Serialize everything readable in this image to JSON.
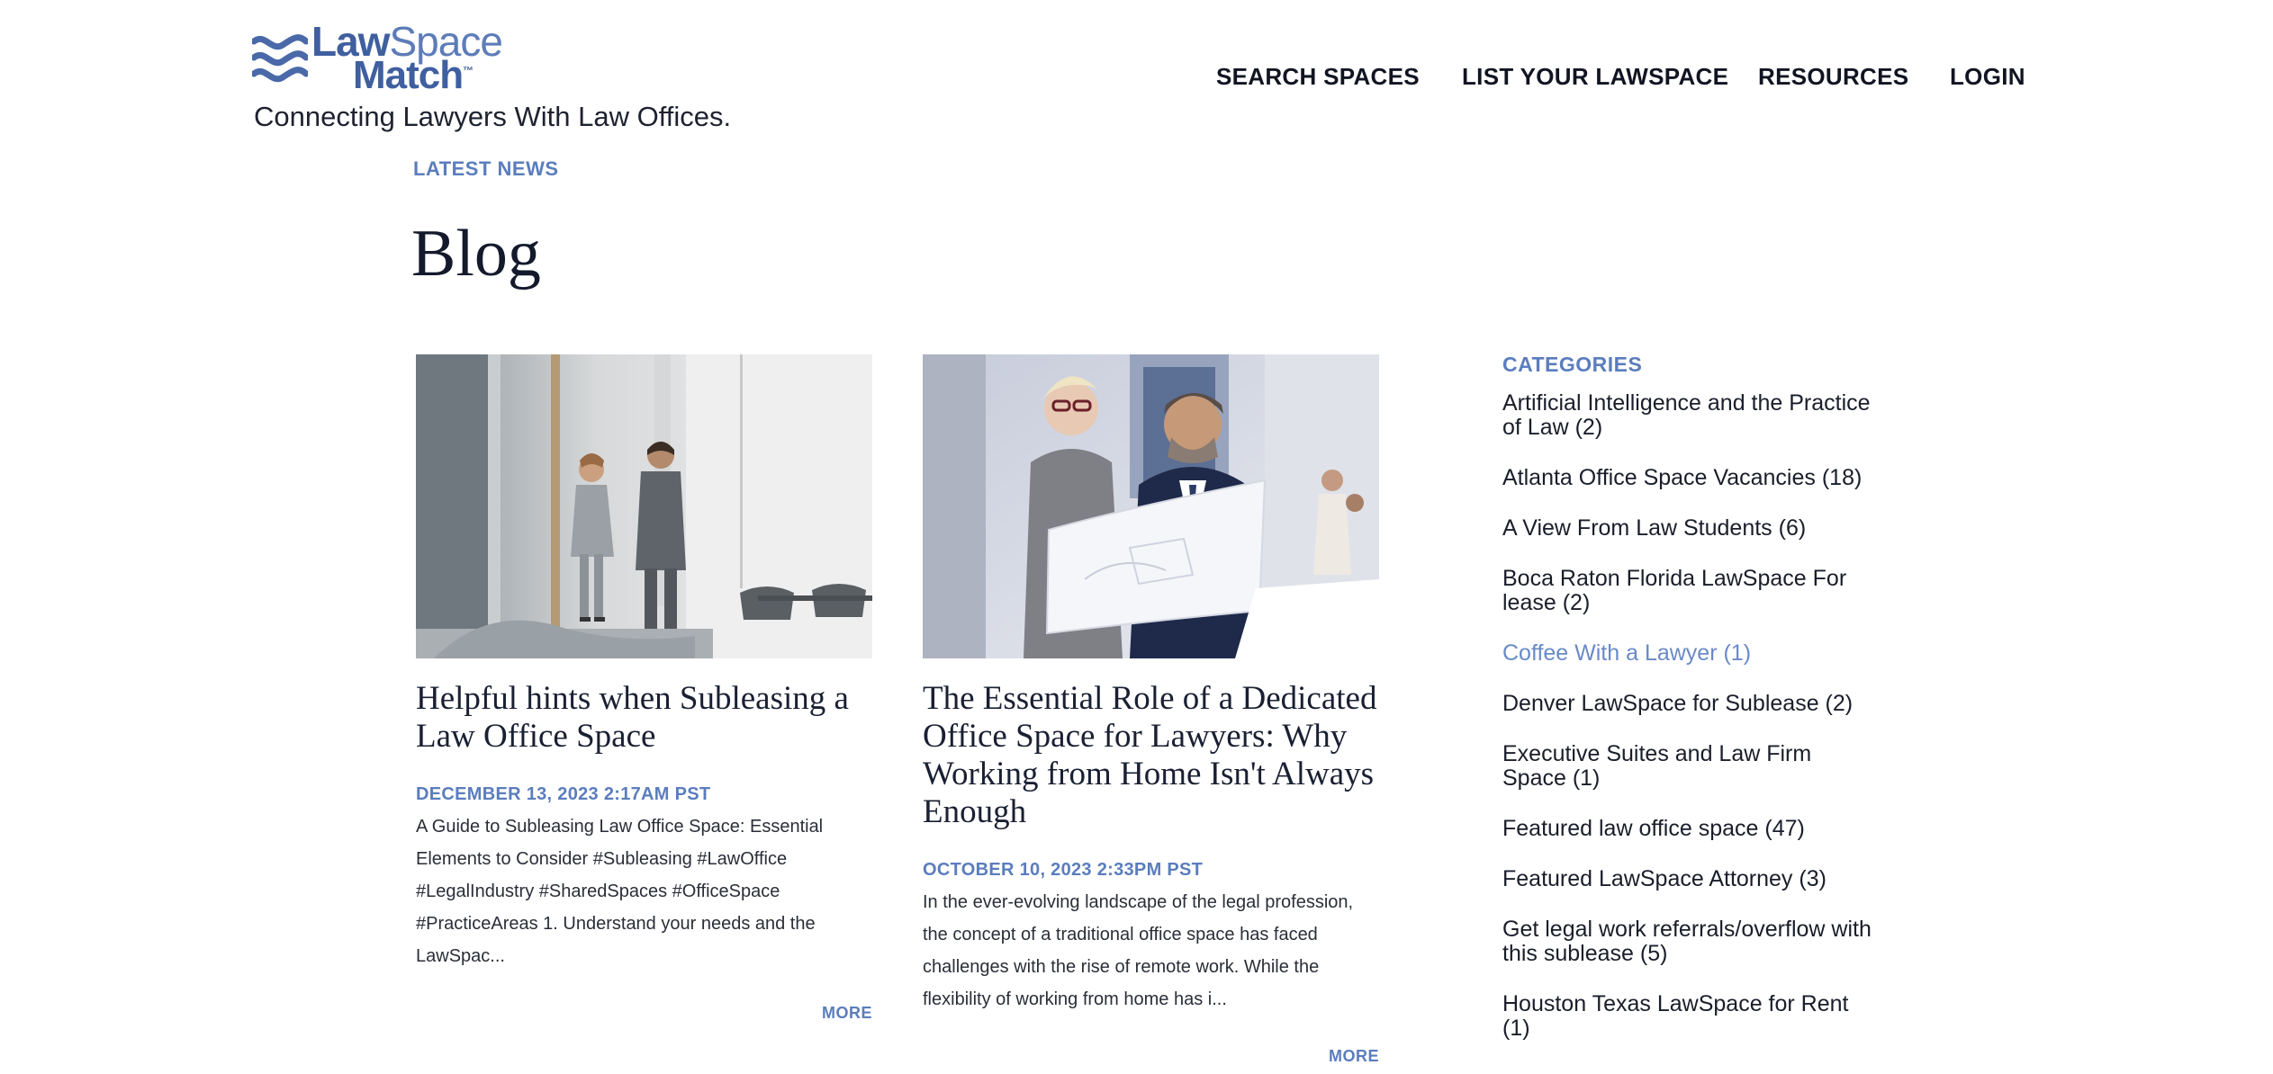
{
  "brand": {
    "logo_line1_a": "Law",
    "logo_line1_b": "Space",
    "logo_line2": "Match",
    "logo_tm": "™",
    "tagline": "Connecting Lawyers With Law Offices."
  },
  "nav": [
    "SEARCH SPACES",
    "LIST YOUR LAWSPACE",
    "RESOURCES",
    "LOGIN"
  ],
  "header": {
    "eyebrow": "LATEST NEWS",
    "title": "Blog"
  },
  "posts": [
    {
      "title": "Helpful hints when Subleasing a Law Office Space",
      "date": "DECEMBER 13, 2023 2:17AM PST",
      "excerpt": "A Guide to Subleasing Law Office Space: Essential Elements to Consider #Subleasing #LawOffice #LegalIndustry #SharedSpaces #OfficeSpace #PracticeAreas 1. Understand your needs and the LawSpac...",
      "more": "MORE"
    },
    {
      "title": "The Essential Role of a Dedicated Office Space for Lawyers: Why Working from Home Isn't Always Enough",
      "date": "OCTOBER 10, 2023 2:33PM PST",
      "excerpt": "In the ever-evolving landscape of the legal profession, the concept of a traditional office space has faced challenges with the rise of remote work. While the flexibility of working from home has i...",
      "more": "MORE"
    }
  ],
  "sidebar": {
    "heading": "CATEGORIES",
    "categories": [
      "Artificial Intelligence and the Practice of Law (2)",
      "Atlanta Office Space Vacancies (18)",
      "A View From Law Students (6)",
      "Boca Raton Florida LawSpace For lease (2)",
      "Coffee With a Lawyer (1)",
      "Denver LawSpace for Sublease (2)",
      "Executive Suites and Law Firm Space (1)",
      "Featured law office space (47)",
      "Featured LawSpace Attorney (3)",
      "Get legal work referrals/overflow with this sublease (5)",
      "Houston Texas LawSpace for Rent (1)"
    ]
  },
  "colors": {
    "accent": "#5b7dbd",
    "logo_blue": "#3f5f9f",
    "heading_navy": "#141a2c",
    "active_category": "#6a8ac8"
  },
  "icons": [
    "logo-wave-icon"
  ]
}
